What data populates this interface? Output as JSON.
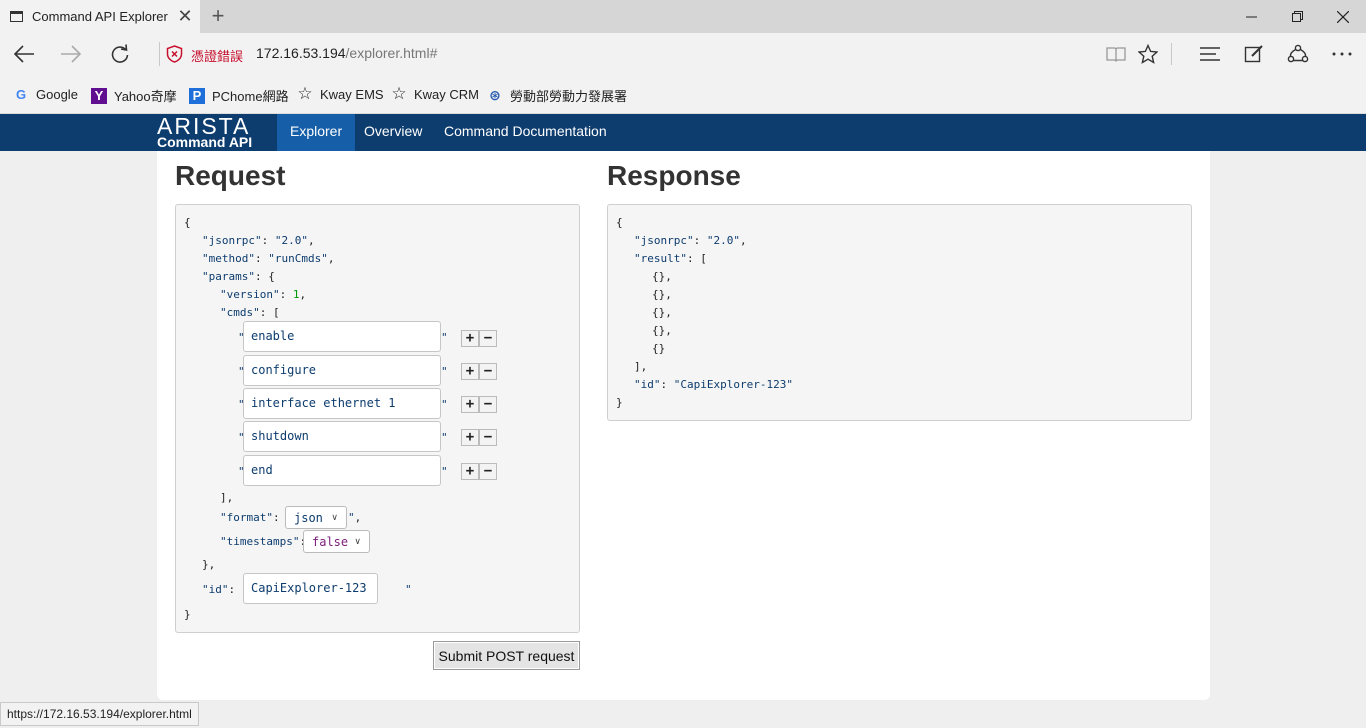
{
  "browser": {
    "tab_title": "Command API Explorer",
    "tab_close": "✕",
    "new_tab": "+",
    "cert_warning": "憑證錯誤",
    "url_host": "172.16.53.194",
    "url_path": "/explorer.html#",
    "favorites": [
      {
        "label": "Google",
        "icon": "G"
      },
      {
        "label": "Yahoo奇摩",
        "icon": "Y"
      },
      {
        "label": "PChome網路",
        "icon": "P"
      },
      {
        "label": "Kway EMS",
        "icon": "☆"
      },
      {
        "label": "Kway CRM",
        "icon": "☆"
      },
      {
        "label": "勞動部勞動力發展署",
        "icon": "⊛"
      }
    ],
    "status_url": "https://172.16.53.194/explorer.html"
  },
  "header": {
    "logo_top": "ARISTA",
    "logo_bottom": "Command API",
    "nav": [
      "Explorer",
      "Overview",
      "Command Documentation"
    ]
  },
  "request": {
    "title": "Request",
    "jsonrpc_key": "\"jsonrpc\"",
    "jsonrpc_val": "\"2.0\"",
    "method_key": "\"method\"",
    "method_val": "\"runCmds\"",
    "params_key": "\"params\"",
    "version_key": "\"version\"",
    "version_val": "1",
    "cmds_key": "\"cmds\"",
    "cmds": [
      "enable",
      "configure",
      "interface ethernet 1",
      "shutdown",
      "end"
    ],
    "format_key": "\"format\"",
    "format_val": "json",
    "timestamps_key": "\"timestamps\"",
    "timestamps_val": "false",
    "id_key": "\"id\"",
    "id_val": "CapiExplorer-123",
    "submit_label": "Submit POST request"
  },
  "response": {
    "title": "Response",
    "jsonrpc_key": "\"jsonrpc\"",
    "jsonrpc_val": "\"2.0\"",
    "result_key": "\"result\"",
    "results": [
      "{},",
      "{},",
      "{},",
      "{},",
      "{}"
    ],
    "id_key": "\"id\"",
    "id_val": "\"CapiExplorer-123\""
  }
}
